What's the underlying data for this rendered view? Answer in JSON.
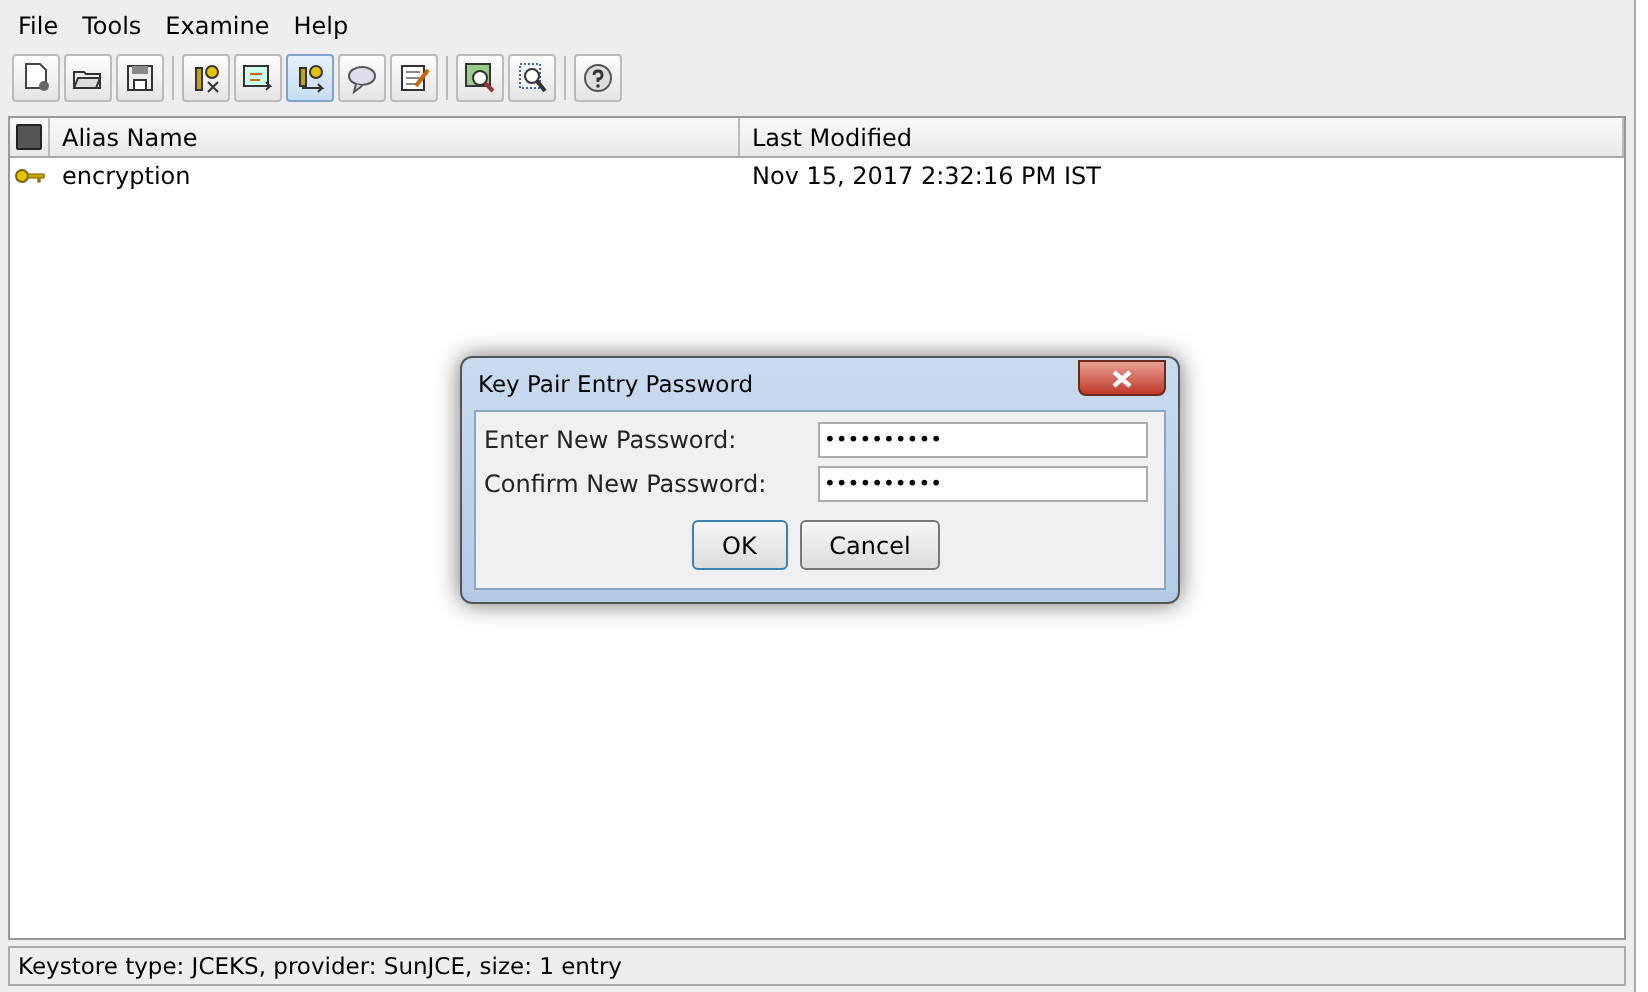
{
  "menu": [
    "File",
    "Tools",
    "Examine",
    "Help"
  ],
  "toolbar": [
    [
      {
        "kind": "new",
        "pressed": false
      },
      {
        "kind": "open",
        "pressed": false
      },
      {
        "kind": "save",
        "pressed": false
      }
    ],
    [
      {
        "kind": "keygen",
        "pressed": false
      },
      {
        "kind": "import",
        "pressed": false
      },
      {
        "kind": "keyimport",
        "pressed": true
      },
      {
        "kind": "chat",
        "pressed": false
      },
      {
        "kind": "edit",
        "pressed": false
      }
    ],
    [
      {
        "kind": "examine",
        "pressed": false
      },
      {
        "kind": "examinefile",
        "pressed": false
      }
    ],
    [
      {
        "kind": "help",
        "pressed": false
      }
    ]
  ],
  "table": {
    "columns": [
      "Alias Name",
      "Last Modified"
    ],
    "rows": [
      {
        "kind": "keypair",
        "alias": "encryption",
        "modified": "Nov 15, 2017 2:32:16 PM IST"
      }
    ]
  },
  "dialog": {
    "title": "Key Pair Entry Password",
    "fields": [
      {
        "label": "Enter New Password:",
        "value": "••••••••••"
      },
      {
        "label": "Confirm New Password:",
        "value": "••••••••••"
      }
    ],
    "buttons": [
      "OK",
      "Cancel"
    ]
  },
  "status_bar": "Keystore type: JCEKS, provider: SunJCE, size: 1 entry"
}
